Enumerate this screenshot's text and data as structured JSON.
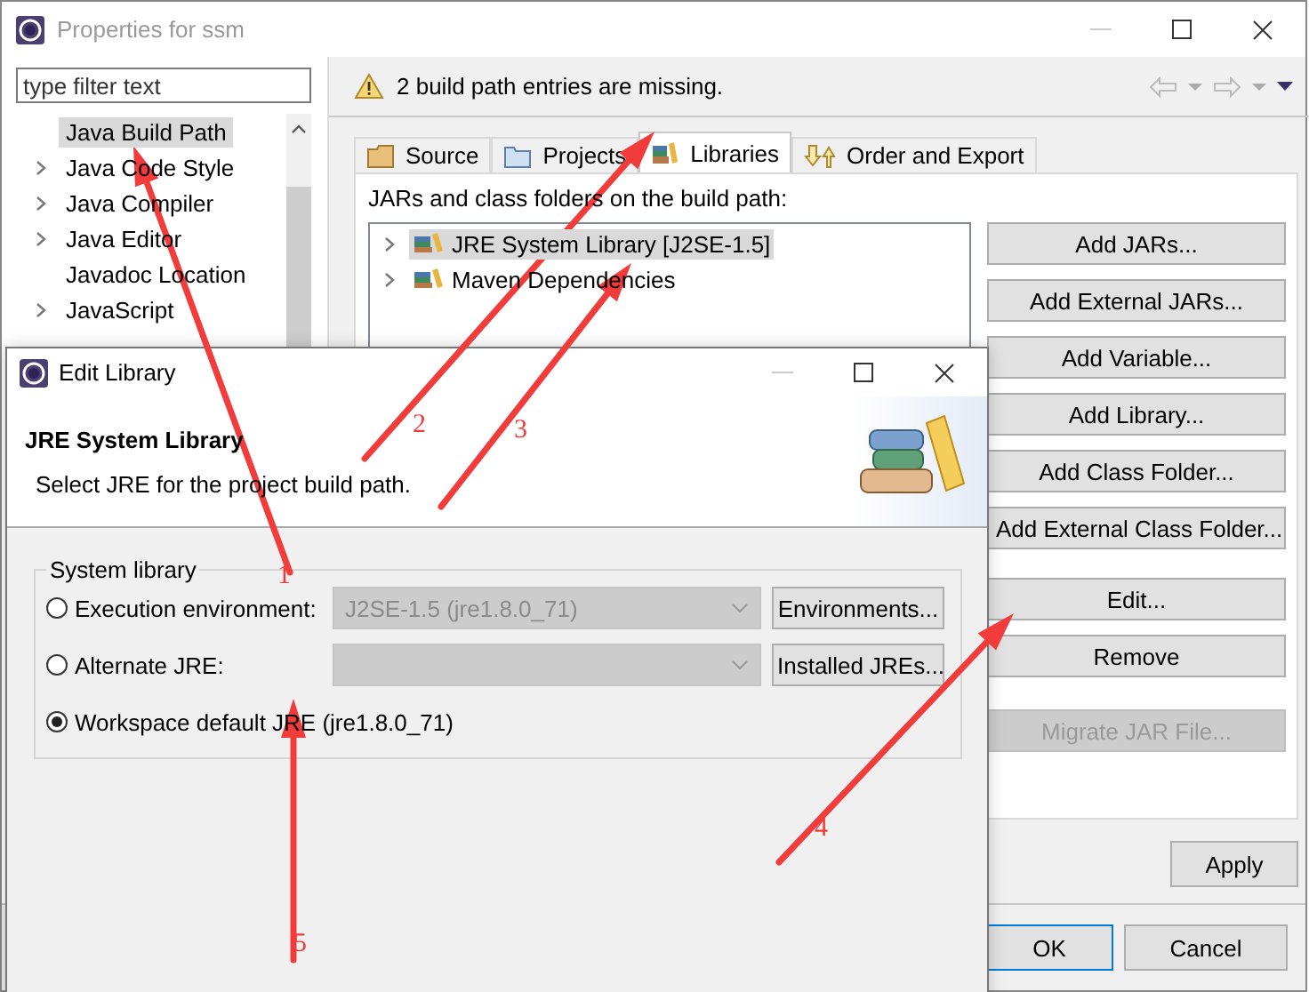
{
  "window": {
    "title": "Properties for ssm"
  },
  "filter": {
    "placeholder": "type filter text"
  },
  "tree": [
    {
      "label": "Java Build Path",
      "expandable": false,
      "selected": true
    },
    {
      "label": "Java Code Style",
      "expandable": true,
      "selected": false
    },
    {
      "label": "Java Compiler",
      "expandable": true,
      "selected": false
    },
    {
      "label": "Java Editor",
      "expandable": true,
      "selected": false
    },
    {
      "label": "Javadoc Location",
      "expandable": false,
      "selected": false
    },
    {
      "label": "JavaScript",
      "expandable": true,
      "selected": false
    }
  ],
  "message": "2 build path entries are missing.",
  "tabs": [
    {
      "label": "Source",
      "selected": false
    },
    {
      "label": "Projects",
      "selected": false
    },
    {
      "label": "Libraries",
      "selected": true
    },
    {
      "label": "Order and Export",
      "selected": false
    }
  ],
  "list_label": "JARs and class folders on the build path:",
  "libraries": [
    {
      "label": "JRE System Library [J2SE-1.5]",
      "selected": true
    },
    {
      "label": "Maven Dependencies",
      "selected": false
    }
  ],
  "buttons": [
    {
      "label": "Add JARs...",
      "disabled": false
    },
    {
      "label": "Add External JARs...",
      "disabled": false
    },
    {
      "label": "Add Variable...",
      "disabled": false
    },
    {
      "label": "Add Library...",
      "disabled": false
    },
    {
      "label": "Add Class Folder...",
      "disabled": false
    },
    {
      "label": "Add External Class Folder...",
      "disabled": false
    },
    {
      "label": "Edit...",
      "disabled": false
    },
    {
      "label": "Remove",
      "disabled": false
    },
    {
      "label": "Migrate JAR File...",
      "disabled": true
    }
  ],
  "apply": "Apply",
  "ok": "OK",
  "cancel": "Cancel",
  "dialog": {
    "title": "Edit Library",
    "heading": "JRE System Library",
    "description": "Select JRE for the project build path.",
    "group": "System library",
    "options": [
      {
        "label": "Execution environment:",
        "selected": false,
        "combo": "J2SE-1.5 (jre1.8.0_71)",
        "button": "Environments..."
      },
      {
        "label": "Alternate JRE:",
        "selected": false,
        "button": "Installed JREs..."
      },
      {
        "label": "Workspace default JRE (jre1.8.0_71)",
        "selected": true
      }
    ]
  },
  "annotations": [
    {
      "label": "1"
    },
    {
      "label": "2"
    },
    {
      "label": "3"
    },
    {
      "label": "4"
    },
    {
      "label": "5"
    }
  ]
}
